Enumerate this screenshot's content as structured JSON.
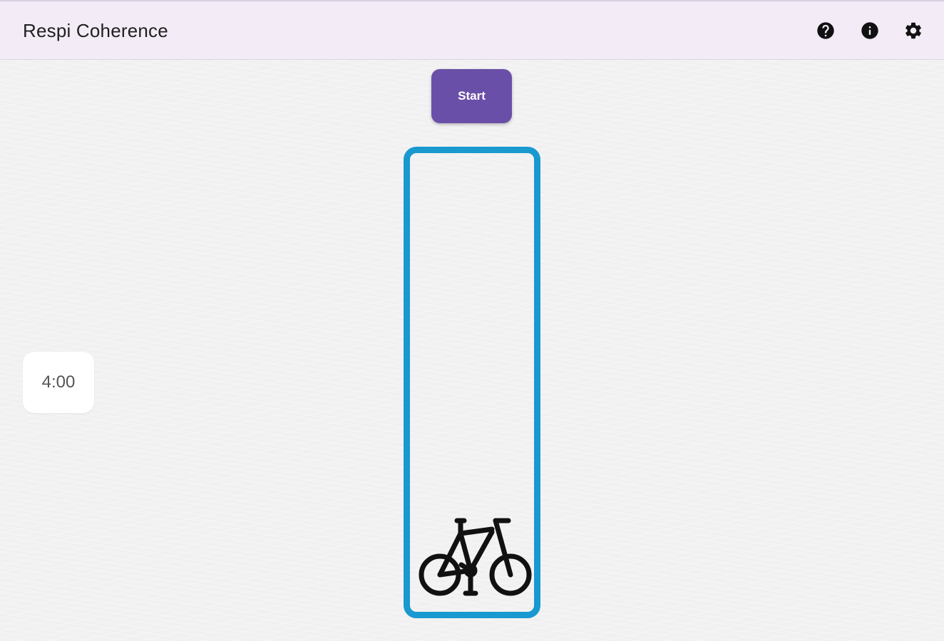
{
  "app_bar": {
    "title": "Respi Coherence",
    "icons": [
      "help-icon",
      "info-icon",
      "settings-icon"
    ]
  },
  "controls": {
    "start_label": "Start"
  },
  "timer": {
    "display": "4:00"
  },
  "breath_track": {
    "indicator_icon": "bicycle-icon",
    "border_color": "#1899cf",
    "progress": 0
  },
  "colors": {
    "app_bar_bg": "#f3ebf6",
    "accent": "#6a4fa8",
    "track": "#1899cf"
  }
}
